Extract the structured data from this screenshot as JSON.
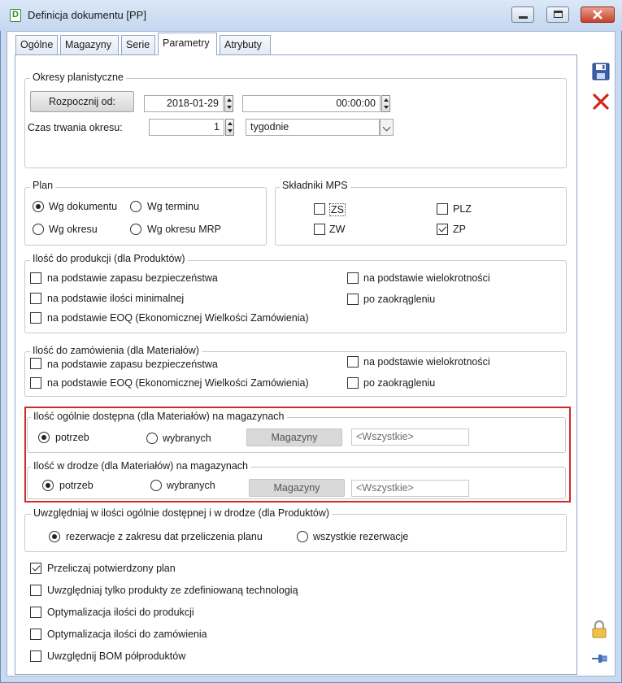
{
  "window": {
    "title": "Definicja dokumentu [PP]",
    "app_icon": "D"
  },
  "tabs": [
    {
      "label": "Ogólne"
    },
    {
      "label": "Magazyny"
    },
    {
      "label": "Serie"
    },
    {
      "label": "Parametry",
      "active": true
    },
    {
      "label": "Atrybuty"
    }
  ],
  "okresy": {
    "legend": "Okresy planistyczne",
    "start_button": "Rozpocznij od:",
    "start_date": "2018-01-29",
    "start_time": "00:00:00",
    "duration_label": "Czas trwania okresu:",
    "duration_value": "1",
    "unit_value": "tygodnie"
  },
  "plan": {
    "legend": "Plan",
    "options": [
      "Wg dokumentu",
      "Wg terminu",
      "Wg okresu",
      "Wg okresu MRP"
    ],
    "selected": "Wg dokumentu"
  },
  "mps": {
    "legend": "Składniki MPS",
    "items": [
      {
        "label": "ZS",
        "checked": false
      },
      {
        "label": "PLZ",
        "checked": false
      },
      {
        "label": "ZW",
        "checked": false
      },
      {
        "label": "ZP",
        "checked": true
      }
    ]
  },
  "produkcja": {
    "legend": "Ilość do produkcji (dla Produktów)",
    "left": [
      "na podstawie zapasu bezpieczeństwa",
      "na podstawie ilości minimalnej",
      "na podstawie EOQ (Ekonomicznej Wielkości Zamówienia)"
    ],
    "right": [
      "na podstawie wielokrotności",
      "po zaokrągleniu"
    ]
  },
  "zamowienie": {
    "legend": "Ilość do zamówienia (dla Materiałów)",
    "left": [
      "na podstawie zapasu bezpieczeństwa",
      "na podstawie EOQ (Ekonomicznej Wielkości Zamówienia)"
    ],
    "right": [
      "na podstawie wielokrotności",
      "po zaokrągleniu"
    ]
  },
  "dostepna": {
    "legend": "Ilość ogólnie dostępna (dla Materiałów) na magazynach",
    "opt1": "potrzeb",
    "opt2": "wybranych",
    "button": "Magazyny",
    "value": "<Wszystkie>"
  },
  "wdrodze": {
    "legend": "Ilość w drodze (dla Materiałów) na magazynach",
    "opt1": "potrzeb",
    "opt2": "wybranych",
    "button": "Magazyny",
    "value": "<Wszystkie>"
  },
  "uwzgledniaj": {
    "legend": "Uwzględniaj w ilości ogólnie dostępnej i w drodze (dla Produktów)",
    "opt1": "rezerwacje z zakresu dat przeliczenia planu",
    "opt2": "wszystkie rezerwacje"
  },
  "options": [
    {
      "label": "Przeliczaj potwierdzony plan",
      "checked": true
    },
    {
      "label": "Uwzględniaj tylko produkty ze zdefiniowaną technologią",
      "checked": false
    },
    {
      "label": "Optymalizacja ilości do produkcji",
      "checked": false
    },
    {
      "label": "Optymalizacja ilości do zamówienia",
      "checked": false
    },
    {
      "label": "Uwzględnij BOM półproduktów",
      "checked": false
    }
  ],
  "toolbar": {
    "icons": [
      "save-icon",
      "cancel-icon",
      "lock-icon",
      "pin-icon"
    ]
  },
  "colors": {
    "accent_red": "#d22a2a",
    "title_bar": "#c4d7ef"
  }
}
